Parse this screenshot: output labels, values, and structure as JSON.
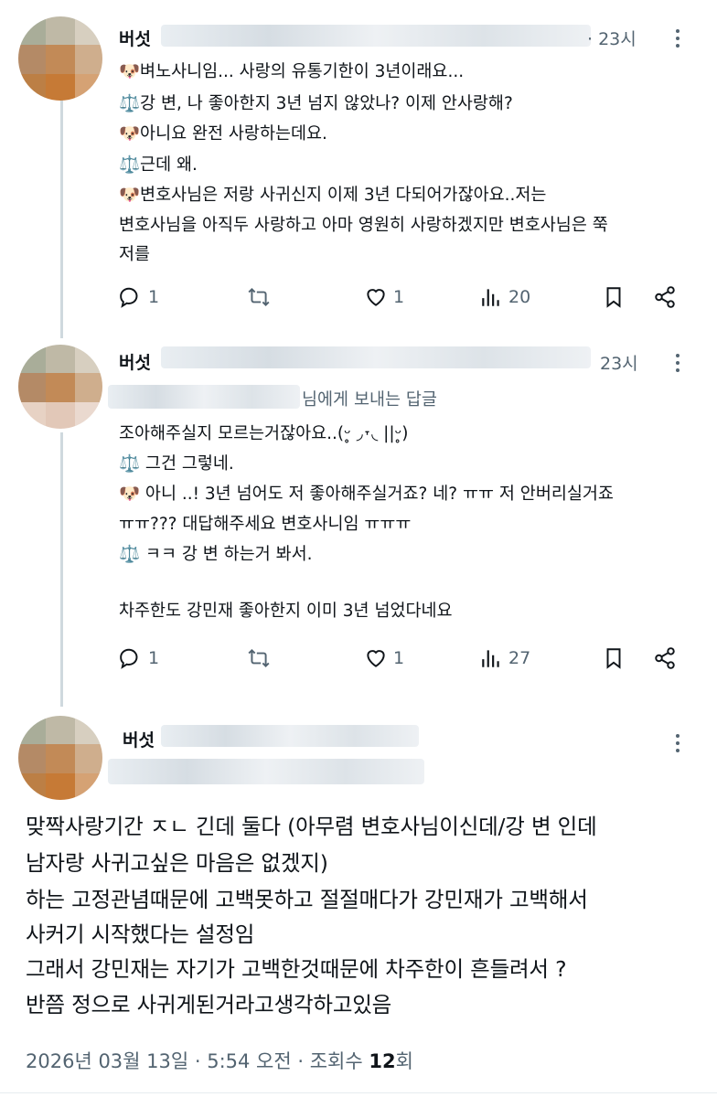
{
  "reply1": {
    "author": "버섯",
    "time": "· 23시",
    "lines": [
      {
        "emoji": "🐶",
        "text": "벼노사니임... 사랑의 유통기한이 3년이래요..."
      },
      {
        "emoji": "⚖️",
        "text": "강 변, 나 좋아한지 3년 넘지 않았나? 이제 안사랑해?"
      },
      {
        "emoji": "🐶",
        "text": "아니요 완전 사랑하는데요."
      },
      {
        "emoji": "⚖️",
        "text": "근데 왜."
      },
      {
        "emoji": "🐶",
        "text": "변호사님은 저랑 사귀신지 이제 3년 다되어가잖아요..저는"
      },
      {
        "emoji": "",
        "text": "변호사님을 아직두 사랑하고 아마 영원히 사랑하겠지만 변호사님은 쭉"
      },
      {
        "emoji": "",
        "text": "저를"
      }
    ],
    "replies": "1",
    "likes": "1",
    "views": "20"
  },
  "reply2": {
    "author": "버섯",
    "time": "23시",
    "replying_to": "님에게 보내는 답글",
    "lines": [
      {
        "emoji": "",
        "text": "조아해주실지 모르는거잖아요..(ᵕ̥ ◞˕◟ ||ᵕ̥)"
      },
      {
        "emoji": "⚖️",
        "text": " 그건 그렇네."
      },
      {
        "emoji": "🐶",
        "text": " 아니 ..! 3년 넘어도 저 좋아해주실거죠? 네? ㅠㅠ 저 안버리실거죠"
      },
      {
        "emoji": "",
        "text": "ㅠㅠ??? 대답해주세요 변호사니임 ㅠㅠㅠ"
      },
      {
        "emoji": "⚖️",
        "text": " ㅋㅋ 강 변 하는거 봐서."
      },
      {
        "emoji": "",
        "text": ""
      },
      {
        "emoji": "",
        "text": "차주한도 강민재 좋아한지 이미 3년 넘었다네요"
      }
    ],
    "replies": "1",
    "likes": "1",
    "views": "27"
  },
  "main": {
    "author": "버섯",
    "lines": [
      "맞짝사랑기간 ㅈㄴ 긴데 둘다 (아무렴 변호사님이신데/강 변 인데",
      "남자랑 사귀고싶은 마음은 없겠지)",
      "하는 고정관념때문에 고백못하고 절절매다가 강민재가 고백해서",
      "사커기 시작했다는 설정임",
      "그래서 강민재는 자기가 고백한것때문에 차주한이 흔들려서 ?",
      "반쯤 정으로 사귀게된거라고생각하고있음"
    ],
    "date": "2026년 03월 13일 · 5:54 오전 · 조회수 ",
    "view_count": "12",
    "view_suffix": "회"
  },
  "icons": [
    "reply-icon",
    "retweet-icon",
    "like-icon",
    "views-icon",
    "bookmark-icon",
    "share-icon",
    "more-icon"
  ],
  "colors": {
    "text": "#0f1419",
    "muted": "#536471",
    "thread_line": "#cfd9de"
  }
}
